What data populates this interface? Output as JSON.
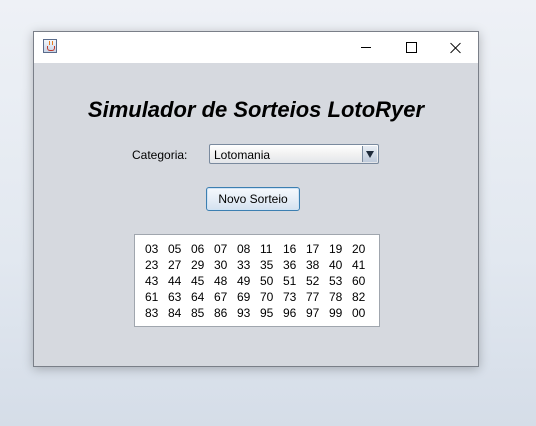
{
  "window": {
    "title_icon": "java-cup-icon"
  },
  "main": {
    "title": "Simulador de Sorteios LotoRyer",
    "category_label": "Categoria:",
    "category_selected": "Lotomania",
    "draw_button_label": "Novo Sorteio",
    "numbers": [
      [
        "03",
        "05",
        "06",
        "07",
        "08",
        "11",
        "16",
        "17",
        "19",
        "20"
      ],
      [
        "23",
        "27",
        "29",
        "30",
        "33",
        "35",
        "36",
        "38",
        "40",
        "41"
      ],
      [
        "43",
        "44",
        "45",
        "48",
        "49",
        "50",
        "51",
        "52",
        "53",
        "60"
      ],
      [
        "61",
        "63",
        "64",
        "67",
        "69",
        "70",
        "73",
        "77",
        "78",
        "82"
      ],
      [
        "83",
        "84",
        "85",
        "86",
        "93",
        "95",
        "96",
        "97",
        "99",
        "00"
      ]
    ]
  }
}
